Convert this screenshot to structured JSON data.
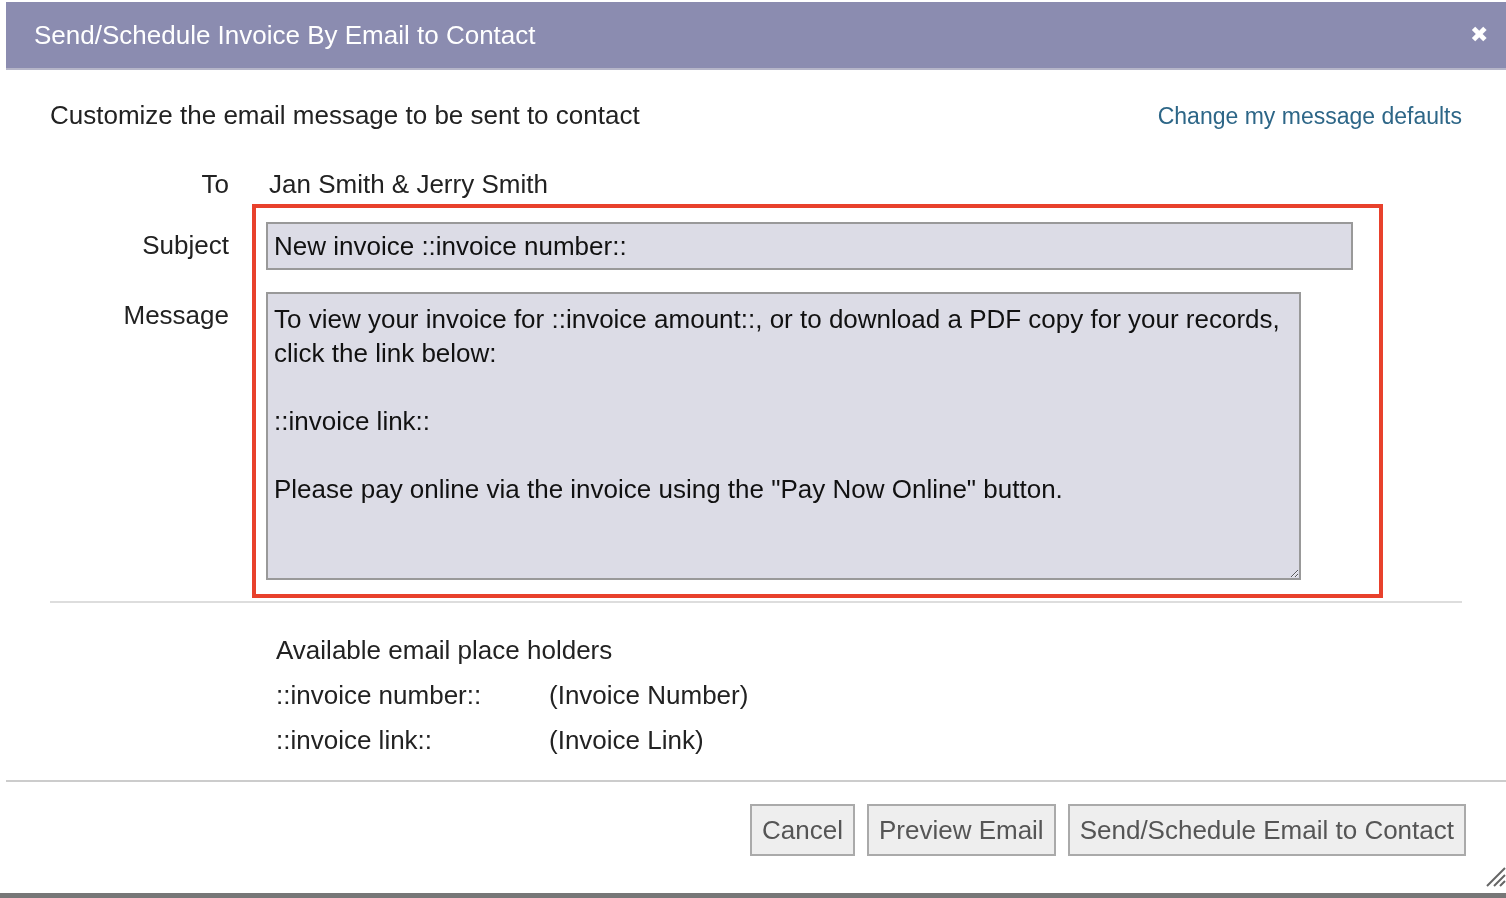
{
  "dialog": {
    "title": "Send/Schedule Invoice By Email to Contact",
    "close": "✖"
  },
  "intro": "Customize the email message to be sent to contact",
  "defaults_link": "Change my message defaults",
  "to": {
    "label": "To",
    "value": "Jan Smith & Jerry Smith"
  },
  "subject": {
    "label": "Subject",
    "value": "New invoice ::invoice number::"
  },
  "message": {
    "label": "Message",
    "value": "To view your invoice for ::invoice amount::, or to download a PDF copy for your records, click the link below:\n\n::invoice link::\n\nPlease pay online via the invoice using the \"Pay Now Online\" button."
  },
  "placeholders": {
    "heading": "Available email place holders",
    "items": [
      {
        "token": "::invoice number::",
        "meaning": "(Invoice Number)"
      },
      {
        "token": "::invoice link::",
        "meaning": "(Invoice Link)"
      }
    ]
  },
  "buttons": [
    "Cancel",
    "Preview Email",
    "Send/Schedule Email to Contact"
  ]
}
